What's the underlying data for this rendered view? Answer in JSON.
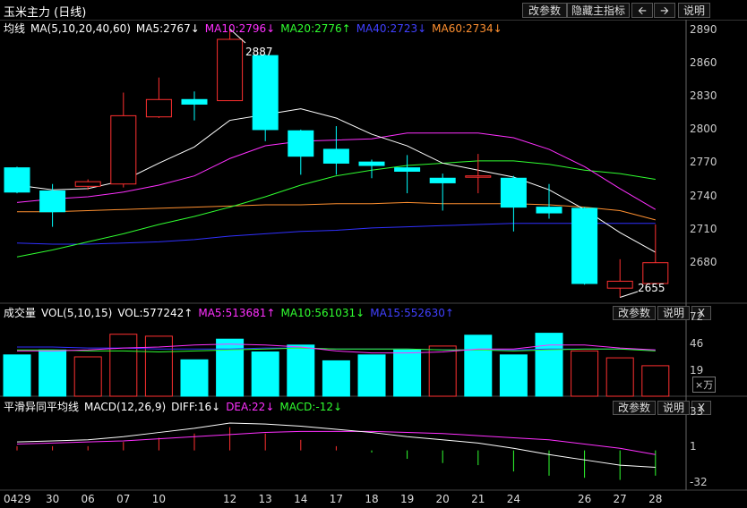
{
  "toolbar": {
    "title": "玉米主力 (日线)",
    "change_params": "改参数",
    "hide_main_indicator": "隐藏主指标",
    "prev_icon": "left-arrow-icon",
    "next_icon": "right-arrow-icon",
    "help": "说明"
  },
  "price_panel": {
    "label": "均线",
    "params": "MA(5,10,20,40,60)",
    "ma5": "MA5:2767↓",
    "ma10": "MA10:2796↓",
    "ma20": "MA20:2776↑",
    "ma40": "MA40:2723↓",
    "ma60": "MA60:2734↓",
    "high_label": "2887",
    "low_label": "2655",
    "ticks": [
      "2890",
      "2860",
      "2830",
      "2800",
      "2770",
      "2740",
      "2710",
      "2680"
    ]
  },
  "vol_panel": {
    "label": "成交量",
    "params": "VOL(5,10,15)",
    "vol": "VOL:577242↑",
    "ma5": "MA5:513681↑",
    "ma10": "MA10:561031↓",
    "ma15": "MA15:552630↑",
    "ticks": [
      "72",
      "46",
      "19"
    ],
    "unit": "×万",
    "change_params": "改参数",
    "help": "说明",
    "close": "X"
  },
  "macd_panel": {
    "label": "平滑异同平均线",
    "params": "MACD(12,26,9)",
    "diff": "DIFF:16↓",
    "dea": "DEA:22↓",
    "macd": "MACD:-12↓",
    "ticks": [
      "33",
      "1",
      "-32"
    ],
    "change_params": "改参数",
    "help": "说明",
    "close": "X"
  },
  "x_axis": [
    "0429",
    "30",
    "06",
    "07",
    "10",
    "12",
    "13",
    "14",
    "17",
    "18",
    "19",
    "20",
    "21",
    "24",
    "26",
    "27",
    "28"
  ],
  "colors": {
    "up": "#ff3030",
    "down": "#00ffff",
    "ma5": "#ffffff",
    "ma10": "#ff30ff",
    "ma20": "#30ff30",
    "ma40": "#3030ff",
    "ma60": "#ff9030"
  },
  "chart_data": {
    "type": "candlestick",
    "ylim": [
      2650,
      2895
    ],
    "candles": [
      {
        "open": 2767,
        "close": 2746,
        "high": 2768,
        "low": 2745
      },
      {
        "open": 2747,
        "close": 2729,
        "high": 2753,
        "low": 2716
      },
      {
        "open": 2751,
        "close": 2755,
        "high": 2757,
        "low": 2748
      },
      {
        "open": 2753,
        "close": 2812,
        "high": 2832,
        "low": 2750
      },
      {
        "open": 2811,
        "close": 2826,
        "high": 2845,
        "low": 2810
      },
      {
        "open": 2826,
        "close": 2822,
        "high": 2833,
        "low": 2808
      },
      {
        "open": 2825,
        "close": 2878,
        "high": 2887,
        "low": 2825
      },
      {
        "open": 2864,
        "close": 2800,
        "high": 2865,
        "low": 2790
      },
      {
        "open": 2799,
        "close": 2777,
        "high": 2800,
        "low": 2761
      },
      {
        "open": 2783,
        "close": 2771,
        "high": 2803,
        "low": 2761
      },
      {
        "open": 2772,
        "close": 2769,
        "high": 2774,
        "low": 2758
      },
      {
        "open": 2767,
        "close": 2764,
        "high": 2778,
        "low": 2745
      },
      {
        "open": 2758,
        "close": 2754,
        "high": 2762,
        "low": 2730
      },
      {
        "open": 2760,
        "close": 2760,
        "high": 2779,
        "low": 2745
      },
      {
        "open": 2758,
        "close": 2733,
        "high": 2760,
        "low": 2712
      },
      {
        "open": 2733,
        "close": 2728,
        "high": 2753,
        "low": 2723
      },
      {
        "open": 2732,
        "close": 2667,
        "high": 2733,
        "low": 2666
      },
      {
        "open": 2663,
        "close": 2669,
        "high": 2688,
        "low": 2655
      },
      {
        "open": 2667,
        "close": 2685,
        "high": 2718,
        "low": 2667
      }
    ],
    "ma5": [
      2752,
      2748,
      2749,
      2756,
      2771,
      2785,
      2808,
      2813,
      2818,
      2810,
      2796,
      2786,
      2771,
      2765,
      2759,
      2748,
      2731,
      2711,
      2694
    ],
    "ma10": [
      2737,
      2740,
      2742,
      2746,
      2752,
      2760,
      2775,
      2786,
      2790,
      2791,
      2792,
      2797,
      2797,
      2797,
      2793,
      2783,
      2768,
      2749,
      2731
    ],
    "ma20": [
      2690,
      2696,
      2703,
      2710,
      2718,
      2725,
      2733,
      2742,
      2752,
      2760,
      2765,
      2769,
      2771,
      2773,
      2773,
      2770,
      2765,
      2762,
      2757
    ],
    "ma40": [
      2702,
      2701,
      2701,
      2702,
      2703,
      2705,
      2708,
      2710,
      2712,
      2713,
      2715,
      2716,
      2717,
      2718,
      2719,
      2719,
      2719,
      2719,
      2719
    ],
    "ma60": [
      2729,
      2729,
      2730,
      2731,
      2732,
      2733,
      2734,
      2735,
      2735,
      2736,
      2736,
      2737,
      2736,
      2736,
      2736,
      2735,
      2733,
      2730,
      2722
    ],
    "volume": {
      "values": [
        42,
        47,
        40,
        63,
        61,
        37,
        58,
        45,
        52,
        36,
        42,
        47,
        51,
        62,
        42,
        64,
        46,
        39,
        31
      ],
      "up": [
        false,
        false,
        true,
        true,
        true,
        false,
        false,
        false,
        false,
        false,
        false,
        false,
        true,
        false,
        false,
        false,
        true,
        true,
        true
      ],
      "ma5": [
        46,
        46,
        47,
        49,
        50,
        52,
        53,
        52,
        50,
        46,
        44,
        44,
        45,
        48,
        48,
        52,
        52,
        49,
        47
      ],
      "ma10": [
        47,
        47,
        46,
        46,
        45,
        46,
        47,
        48,
        49,
        48,
        48,
        48,
        47,
        47,
        46,
        47,
        48,
        48,
        46
      ],
      "ma15": [
        50,
        50,
        49,
        49,
        48,
        48,
        48,
        49,
        49,
        48,
        48,
        48,
        47,
        47,
        47,
        48,
        48,
        48,
        47
      ],
      "ylim": [
        0,
        80
      ]
    },
    "macd": {
      "diff": [
        8,
        9,
        10,
        13,
        17,
        21,
        26,
        25,
        23,
        20,
        17,
        13,
        10,
        7,
        2,
        -4,
        -9,
        -14,
        -16
      ],
      "dea": [
        6,
        7,
        8,
        9,
        11,
        13,
        15,
        17,
        18,
        18,
        18,
        17,
        16,
        14,
        12,
        10,
        6,
        2,
        -4
      ],
      "hist": [
        4,
        4,
        4,
        8,
        12,
        16,
        22,
        16,
        10,
        4,
        -2,
        -8,
        -12,
        -14,
        -20,
        -24,
        -26,
        -28,
        -24
      ],
      "ylim": [
        -36,
        37
      ]
    }
  }
}
